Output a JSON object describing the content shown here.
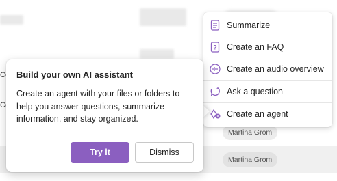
{
  "background": {
    "row_left_texts": [
      "Ce",
      "Ce"
    ],
    "owner_pills": [
      "Martina Grom",
      "Martina Grom"
    ]
  },
  "context_menu": {
    "items": [
      {
        "label": "Summarize",
        "icon": "summary-document-icon"
      },
      {
        "label": "Create an FAQ",
        "icon": "faq-document-icon"
      },
      {
        "label": "Create an audio overview",
        "icon": "audio-waveform-icon"
      },
      {
        "label": "Ask a question",
        "icon": "chat-sparkle-icon"
      },
      {
        "label": "Create an agent",
        "icon": "agent-sparkle-icon"
      }
    ],
    "accent_color": "#8b5fc0"
  },
  "callout": {
    "title": "Build your own AI assistant",
    "body": "Create an agent with your files or folders to help you answer questions, summarize information, and stay organized.",
    "primary_button": "Try it",
    "secondary_button": "Dismiss"
  }
}
